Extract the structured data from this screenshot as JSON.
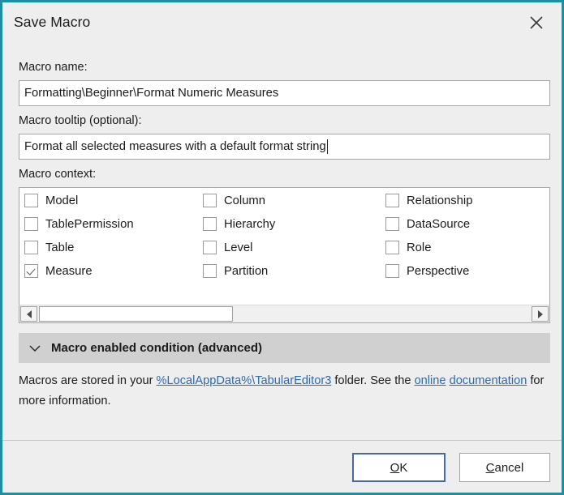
{
  "window": {
    "title": "Save Macro",
    "close_icon": "close-icon",
    "border_color": "#1d8f9e",
    "background_color": "#efeeee"
  },
  "form": {
    "name_label": "Macro name:",
    "name_value": "Formatting\\Beginner\\Format Numeric Measures",
    "tooltip_label": "Macro tooltip (optional):",
    "tooltip_value": "Format all selected measures with a default format string",
    "context_label": "Macro context:"
  },
  "context": {
    "columns": [
      [
        {
          "label": "Model",
          "checked": false
        },
        {
          "label": "TablePermission",
          "checked": false
        },
        {
          "label": "Table",
          "checked": false
        },
        {
          "label": "Measure",
          "checked": true
        }
      ],
      [
        {
          "label": "Column",
          "checked": false
        },
        {
          "label": "Hierarchy",
          "checked": false
        },
        {
          "label": "Level",
          "checked": false
        },
        {
          "label": "Partition",
          "checked": false
        }
      ],
      [
        {
          "label": "Relationship",
          "checked": false
        },
        {
          "label": "DataSource",
          "checked": false
        },
        {
          "label": "Role",
          "checked": false
        },
        {
          "label": "Perspective",
          "checked": false
        }
      ]
    ]
  },
  "scrollbar": {
    "left_arrow_icon": "triangle-left-icon",
    "right_arrow_icon": "triangle-right-icon"
  },
  "advanced": {
    "chevron_icon": "chevron-down-icon",
    "title": "Macro enabled condition (advanced)"
  },
  "info": {
    "part1": "Macros are stored in your ",
    "link1": "%LocalAppData%\\TabularEditor3",
    "part2": " folder. See the ",
    "link2a": "online",
    "link2b": "documentation",
    "part3": " for more information.",
    "link_color": "#2a6ab0"
  },
  "footer": {
    "ok_accel": "O",
    "ok_rest": "K",
    "cancel_accel": "C",
    "cancel_rest": "ancel",
    "ok_border_color": "#46699e"
  }
}
